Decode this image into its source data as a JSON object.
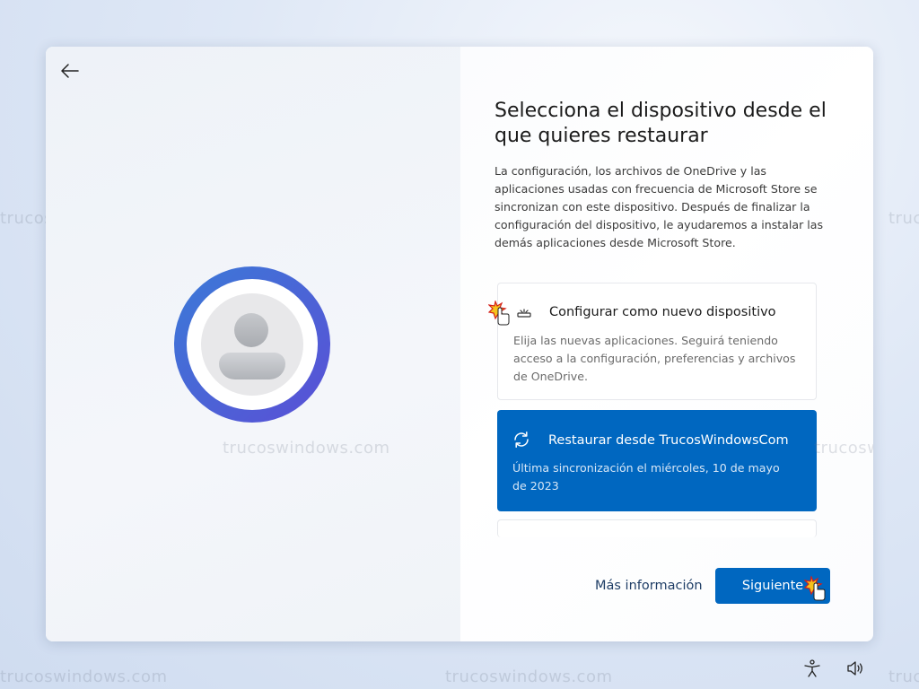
{
  "header": {
    "title": "Selecciona el dispositivo desde el que quieres restaurar",
    "description": "La configuración, los archivos de OneDrive y las aplicaciones usadas con frecuencia de Microsoft Store se sincronizan con este dispositivo. Después de finalizar la configuración del dispositivo, le ayudaremos a instalar las demás aplicaciones desde Microsoft Store."
  },
  "options": [
    {
      "title": "Configurar como nuevo dispositivo",
      "description": "Elija las nuevas aplicaciones. Seguirá teniendo acceso a la configuración, preferencias y archivos de OneDrive.",
      "icon": "new-device-icon",
      "selected": false
    },
    {
      "title": "Restaurar desde TrucosWindowsCom",
      "description": "Última sincronización el miércoles, 10 de mayo de 2023",
      "icon": "sync-icon",
      "selected": true
    }
  ],
  "footer": {
    "more_info": "Más información",
    "next": "Siguiente"
  },
  "watermark": "trucoswindows.com",
  "colors": {
    "accent": "#0067c0",
    "avatar_gradient_start": "#3b7ad7",
    "avatar_gradient_end": "#5a4fd6"
  },
  "taskbar": {
    "icons": [
      "accessibility-icon",
      "volume-icon"
    ]
  }
}
